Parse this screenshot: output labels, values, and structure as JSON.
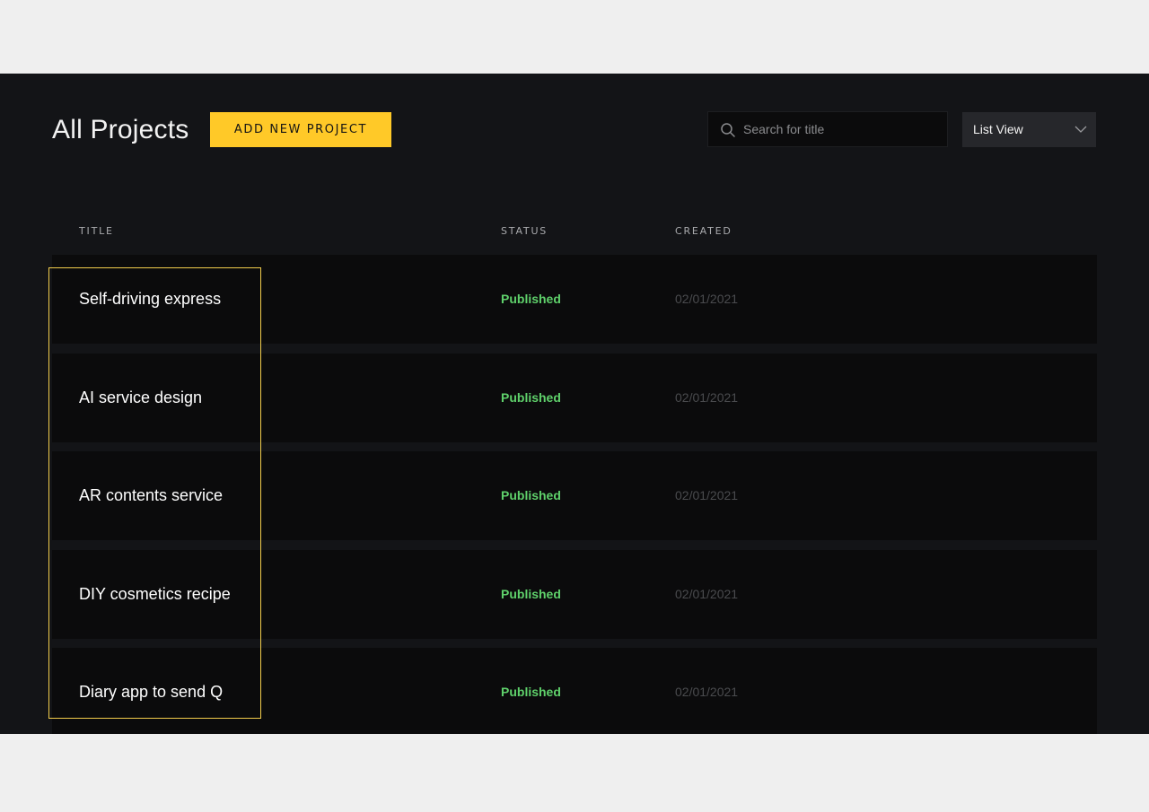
{
  "header": {
    "title": "All Projects",
    "add_button_label": "ADD NEW PROJECT"
  },
  "search": {
    "placeholder": "Search for title",
    "value": "",
    "icon": "search-icon"
  },
  "view_select": {
    "selected": "List View",
    "icon": "chevron-down-icon"
  },
  "table": {
    "columns": {
      "title": "TITLE",
      "status": "STATUS",
      "created": "CREATED"
    },
    "rows": [
      {
        "title": "Self-driving express",
        "status": "Published",
        "created": "02/01/2021"
      },
      {
        "title": "AI service design",
        "status": "Published",
        "created": "02/01/2021"
      },
      {
        "title": "AR contents service",
        "status": "Published",
        "created": "02/01/2021"
      },
      {
        "title": "DIY cosmetics recipe",
        "status": "Published",
        "created": "02/01/2021"
      },
      {
        "title": "Diary app to send Q",
        "status": "Published",
        "created": "02/01/2021"
      }
    ]
  },
  "colors": {
    "accent": "#ffc928",
    "published": "#5fd16b",
    "background": "#131417",
    "row_background": "#0b0b0c",
    "highlight": "#f2cd4c"
  }
}
